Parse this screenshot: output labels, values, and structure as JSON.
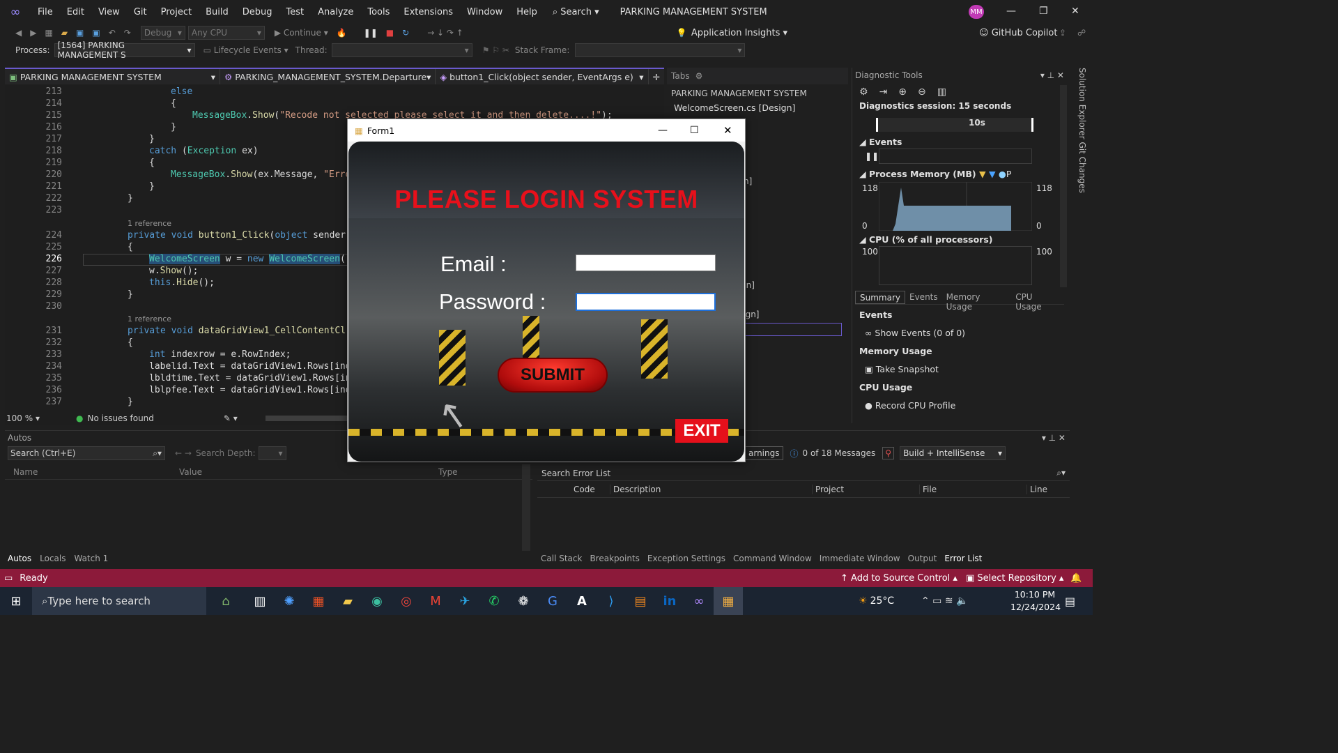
{
  "menu": {
    "items": [
      "File",
      "Edit",
      "View",
      "Git",
      "Project",
      "Build",
      "Debug",
      "Test",
      "Analyze",
      "Tools",
      "Extensions",
      "Window",
      "Help"
    ],
    "search": "Search",
    "title": "PARKING MANAGEMENT SYSTEM",
    "avatar": "MM"
  },
  "toolbar": {
    "config": "Debug",
    "platform": "Any CPU",
    "continue": "Continue",
    "insights": "Application Insights",
    "copilot": "GitHub Copilot"
  },
  "debugbar": {
    "process_label": "Process:",
    "process_value": "[1564] PARKING MANAGEMENT S",
    "lifecycle": "Lifecycle Events",
    "thread_label": "Thread:",
    "stackframe_label": "Stack Frame:"
  },
  "editor": {
    "project": "PARKING MANAGEMENT SYSTEM",
    "class": "PARKING_MANAGEMENT_SYSTEM.Departure",
    "method": "button1_Click(object sender, EventArgs e)",
    "zoom": "100 %",
    "issues": "No issues found",
    "ref1": "1 reference",
    "ref2": "1 reference",
    "lines": [
      "213",
      "214",
      "215",
      "216",
      "217",
      "218",
      "219",
      "220",
      "221",
      "222",
      "223",
      "224",
      "225",
      "226",
      "227",
      "228",
      "229",
      "230",
      "231",
      "232",
      "233",
      "234",
      "235",
      "236",
      "237"
    ]
  },
  "tabs_panel": {
    "title": "Tabs",
    "project": "PARKING MANAGEMENT SYSTEM",
    "file": "WelcomeScreen.cs [Design]",
    "frag1": "n]",
    "frag2": "gn]",
    "frag3": "sign]"
  },
  "diagnostics": {
    "title": "Diagnostic Tools",
    "session": "Diagnostics session: 15 seconds",
    "tick": "10s",
    "events": "Events",
    "memory": "Process Memory (MB)",
    "mem_legend": "P",
    "mem_max": "118",
    "mem_min": "0",
    "cpu": "CPU (% of all processors)",
    "cpu_max": "100",
    "tabs": [
      "Summary",
      "Events",
      "Memory Usage",
      "CPU Usage"
    ],
    "sections": [
      {
        "head": "Events",
        "action": "Show Events (0 of 0)"
      },
      {
        "head": "Memory Usage",
        "action": "Take Snapshot"
      },
      {
        "head": "CPU Usage",
        "action": "Record CPU Profile"
      }
    ]
  },
  "autos": {
    "title": "Autos",
    "search": "Search (Ctrl+E)",
    "depth": "Search Depth:",
    "cols": [
      "Name",
      "Value",
      "Type"
    ],
    "tabs": [
      "Autos",
      "Locals",
      "Watch 1"
    ]
  },
  "errorlist": {
    "warnings": "arnings",
    "messages": "0 of 18 Messages",
    "filter": "Build + IntelliSense",
    "search": "Search Error List",
    "cols": [
      "Code",
      "Description",
      "Project",
      "File",
      "Line"
    ],
    "tabs": [
      "Call Stack",
      "Breakpoints",
      "Exception Settings",
      "Command Window",
      "Immediate Window",
      "Output",
      "Error List"
    ]
  },
  "form": {
    "title": "Form1",
    "heading": "PLEASE LOGIN SYSTEM",
    "email_label": "Email  :",
    "password_label": "Password  :",
    "email_value": "",
    "password_value": "",
    "submit": "SUBMIT",
    "exit": "EXIT"
  },
  "status": {
    "ready": "Ready",
    "source_control": "Add to Source Control",
    "repository": "Select Repository"
  },
  "taskbar": {
    "search": "Type here to search",
    "temp": "25°C",
    "time": "10:10 PM",
    "date": "12/24/2024",
    "notif": "1"
  }
}
